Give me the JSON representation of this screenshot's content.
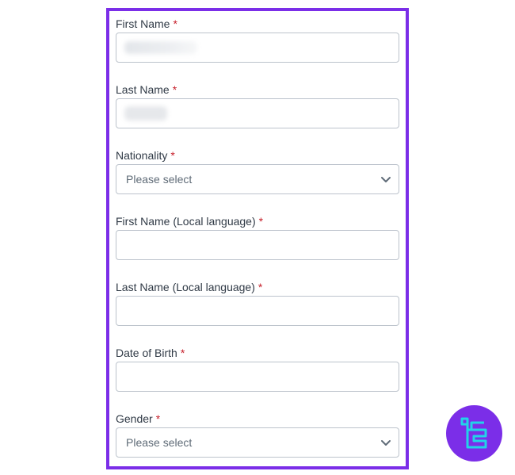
{
  "form": {
    "first_name_label": "First Name",
    "last_name_label": "Last Name",
    "nationality_label": "Nationality",
    "nationality_placeholder": "Please select",
    "first_name_local_label": "First Name (Local language)",
    "last_name_local_label": "Last Name (Local language)",
    "dob_label": "Date of Birth",
    "gender_label": "Gender",
    "gender_placeholder": "Please select",
    "required_mark": "*"
  },
  "colors": {
    "frame_border": "#7b2ee8",
    "required": "#c61f2a",
    "logo_bg": "#7b2ee8",
    "logo_accent": "#22d3e8"
  },
  "icons": {
    "select_arrow": "chevron-down-icon",
    "brand": "brand-logo-icon"
  }
}
